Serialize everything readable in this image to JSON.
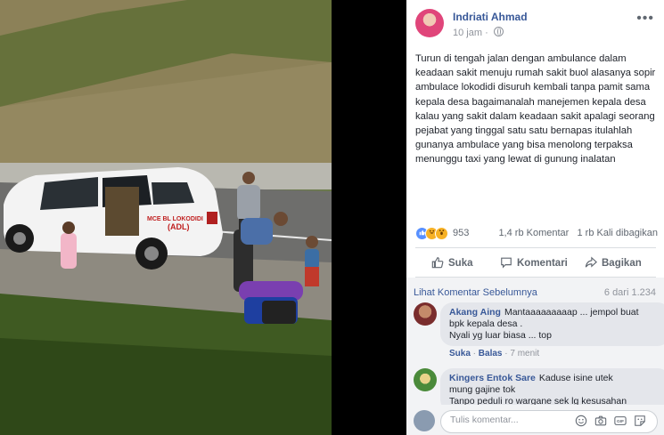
{
  "post": {
    "author": "Indriati Ahmad",
    "time": "10 jam",
    "more_glyph": "•••",
    "text": "Turun di tengah jalan dengan ambulance dalam keadaan sakit menuju rumah sakit buol alasanya sopir ambulace lokodidi disuruh kembali tanpa pamit sama kepala desa bagaimanalah manejemen kepala desa kalau yang sakit dalam keadaan sakit apalagi seorang pejabat yang tinggal satu satu bernapas itulahlah gunanya ambulace yang bisa menolong terpaksa menunggu taxi yang lewat di gunung inalatan"
  },
  "photo": {
    "car_text_1": "MCE BL LOKODIDI",
    "car_text_2": "(ADL)"
  },
  "stats": {
    "reactions": "953",
    "comments": "1,4 rb Komentar",
    "shares": "1 rb Kali dibagikan"
  },
  "actions": {
    "like": "Suka",
    "comment": "Komentari",
    "share": "Bagikan"
  },
  "comments": {
    "prev_link": "Lihat Komentar Sebelumnya",
    "count": "6 dari 1.234",
    "items": [
      {
        "name": "Akang Aing",
        "line1": "Mantaaaaaaaaap ... jempol buat",
        "line2": "bpk kepala desa .",
        "line3": "Nyali yg luar biasa ... top",
        "like": "Suka",
        "reply": "Balas",
        "time": "7 menit"
      },
      {
        "name": "Kingers Entok Sare",
        "line1": "Kaduse isine utek",
        "line2": "mung gajine tok",
        "line3": "Tanpo peduli ro wargane sek lg kesusahan"
      }
    ]
  },
  "input": {
    "placeholder": "Tulis komentar..."
  },
  "colors": {
    "link": "#385898",
    "like_blue": "#5890ff",
    "bubble": "#e4e6eb"
  },
  "icons": [
    "globe-icon",
    "like-icon",
    "haha-icon",
    "wow-icon",
    "thumb-icon",
    "comment-icon",
    "share-icon",
    "emoji-icon",
    "camera-icon",
    "gif-icon",
    "sticker-icon"
  ]
}
